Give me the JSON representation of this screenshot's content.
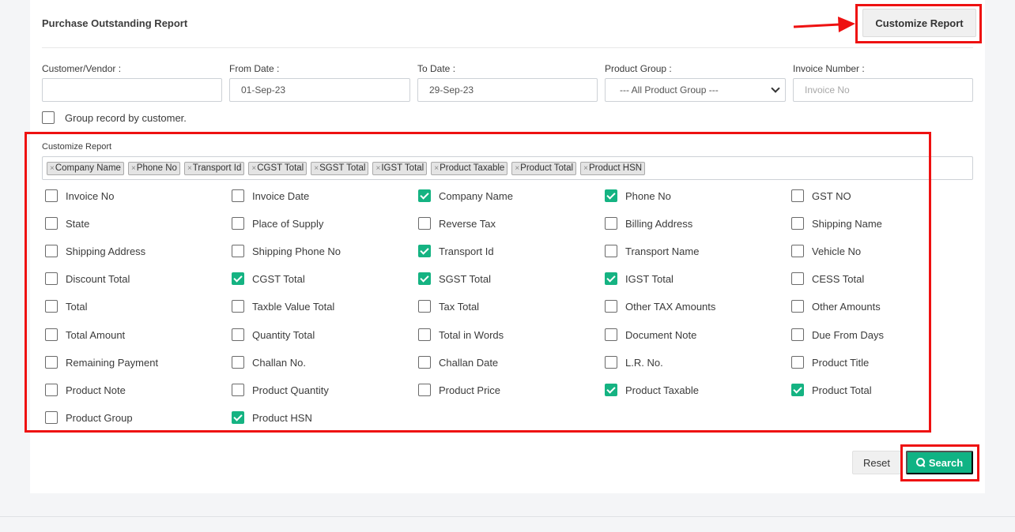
{
  "report": {
    "title": "Purchase Outstanding Report",
    "customize_button": "Customize Report"
  },
  "filters": {
    "customer_label": "Customer/Vendor :",
    "customer_value": "",
    "from_label": "From Date :",
    "from_value": "01-Sep-23",
    "to_label": "To Date :",
    "to_value": "29-Sep-23",
    "group_label": "Product Group :",
    "group_value": "--- All Product Group ---",
    "invoice_label": "Invoice Number :",
    "invoice_placeholder": "Invoice No",
    "group_by_customer_label": "Group record by customer.",
    "group_by_customer_checked": false
  },
  "customize": {
    "label": "Customize Report",
    "tags": [
      "Company Name",
      "Phone No",
      "Transport Id",
      "CGST Total",
      "SGST Total",
      "IGST Total",
      "Product Taxable",
      "Product Total",
      "Product HSN"
    ],
    "columns": [
      [
        {
          "label": "Invoice No",
          "checked": false
        },
        {
          "label": "State",
          "checked": false
        },
        {
          "label": "Shipping Address",
          "checked": false
        },
        {
          "label": "Discount Total",
          "checked": false
        },
        {
          "label": "Total",
          "checked": false
        },
        {
          "label": "Total Amount",
          "checked": false
        },
        {
          "label": "Remaining Payment",
          "checked": false
        },
        {
          "label": "Product Note",
          "checked": false
        },
        {
          "label": "Product Group",
          "checked": false
        }
      ],
      [
        {
          "label": "Invoice Date",
          "checked": false
        },
        {
          "label": "Place of Supply",
          "checked": false
        },
        {
          "label": "Shipping Phone No",
          "checked": false
        },
        {
          "label": "CGST Total",
          "checked": true
        },
        {
          "label": "Taxble Value Total",
          "checked": false
        },
        {
          "label": "Quantity Total",
          "checked": false
        },
        {
          "label": "Challan No.",
          "checked": false
        },
        {
          "label": "Product Quantity",
          "checked": false
        },
        {
          "label": "Product HSN",
          "checked": true
        }
      ],
      [
        {
          "label": "Company Name",
          "checked": true
        },
        {
          "label": "Reverse Tax",
          "checked": false
        },
        {
          "label": "Transport Id",
          "checked": true
        },
        {
          "label": "SGST Total",
          "checked": true
        },
        {
          "label": "Tax Total",
          "checked": false
        },
        {
          "label": "Total in Words",
          "checked": false
        },
        {
          "label": "Challan Date",
          "checked": false
        },
        {
          "label": "Product Price",
          "checked": false
        }
      ],
      [
        {
          "label": "Phone No",
          "checked": true
        },
        {
          "label": "Billing Address",
          "checked": false
        },
        {
          "label": "Transport Name",
          "checked": false
        },
        {
          "label": "IGST Total",
          "checked": true
        },
        {
          "label": "Other TAX Amounts",
          "checked": false
        },
        {
          "label": "Document Note",
          "checked": false
        },
        {
          "label": "L.R. No.",
          "checked": false
        },
        {
          "label": "Product Taxable",
          "checked": true
        }
      ],
      [
        {
          "label": "GST NO",
          "checked": false
        },
        {
          "label": "Shipping Name",
          "checked": false
        },
        {
          "label": "Vehicle No",
          "checked": false
        },
        {
          "label": "CESS Total",
          "checked": false
        },
        {
          "label": "Other Amounts",
          "checked": false
        },
        {
          "label": "Due From Days",
          "checked": false
        },
        {
          "label": "Product Title",
          "checked": false
        },
        {
          "label": "Product Total",
          "checked": true
        }
      ]
    ]
  },
  "actions": {
    "reset_label": "Reset",
    "search_label": "Search"
  },
  "annotation_colors": {
    "highlight": "#ee1111",
    "accent": "#10b384"
  }
}
